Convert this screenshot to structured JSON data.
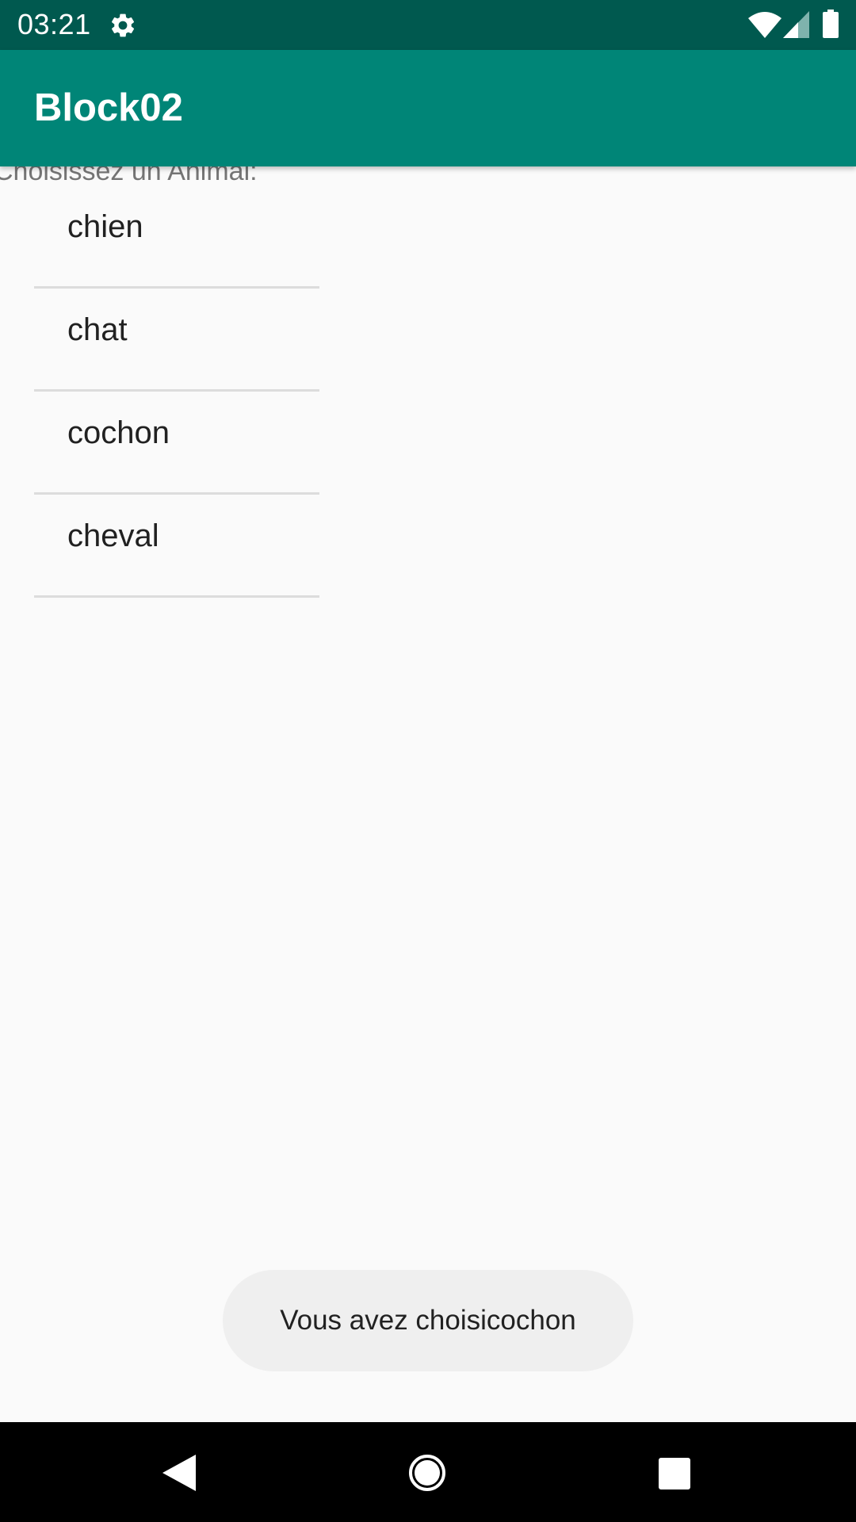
{
  "status_bar": {
    "time": "03:21",
    "background_color": "#00594f",
    "icons": [
      "gear-icon",
      "wifi-icon",
      "signal-icon",
      "battery-icon"
    ]
  },
  "app_bar": {
    "title": "Block02",
    "background_color": "#008577"
  },
  "content": {
    "prompt_label": "Choisissez un Animal:",
    "animals": [
      {
        "label": "chien"
      },
      {
        "label": "chat"
      },
      {
        "label": "cochon"
      },
      {
        "label": "cheval"
      }
    ]
  },
  "toast": {
    "message": "Vous avez choisicochon"
  },
  "nav_bar": {
    "icons": [
      "back-icon",
      "home-icon",
      "recents-icon"
    ]
  }
}
